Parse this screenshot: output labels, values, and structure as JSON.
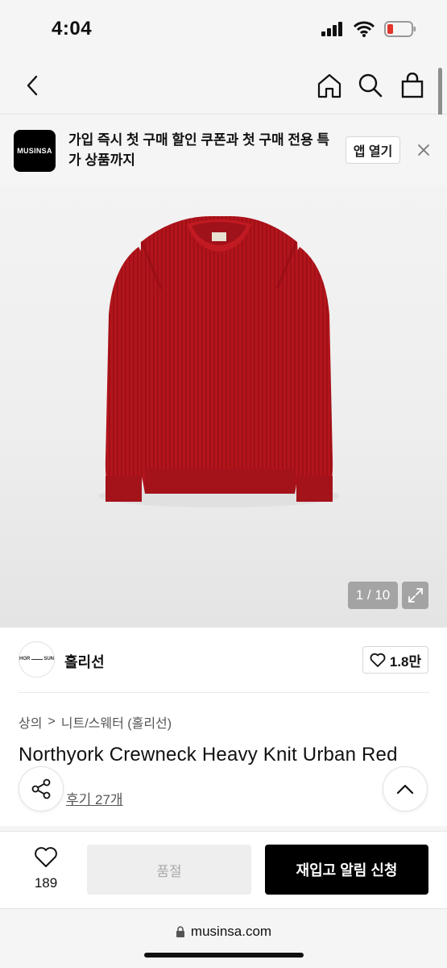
{
  "status": {
    "time": "4:04"
  },
  "banner": {
    "logo_text": "MUSINSA",
    "message": "가입 즉시 첫 구매 할인 쿠폰과 첫 구매 전용 특가 상품까지",
    "open_label": "앱 열기"
  },
  "gallery": {
    "counter": "1 / 10",
    "product_color": "#b3141b"
  },
  "brand": {
    "logo_text_1": "HOR",
    "logo_text_2": "SUN",
    "name": "홀리선",
    "likes": "1.8만"
  },
  "breadcrumb": {
    "category": "상의",
    "separator": ">",
    "subcategory": "니트/스웨터 (홀리선)"
  },
  "product": {
    "title": "Northyork Crewneck Heavy Knit Urban Red",
    "reviews": "후기 27개"
  },
  "actions": {
    "wish_count": "189",
    "soldout_label": "품절",
    "restock_label": "재입고 알림 신청"
  },
  "browser": {
    "url": "musinsa.com"
  }
}
